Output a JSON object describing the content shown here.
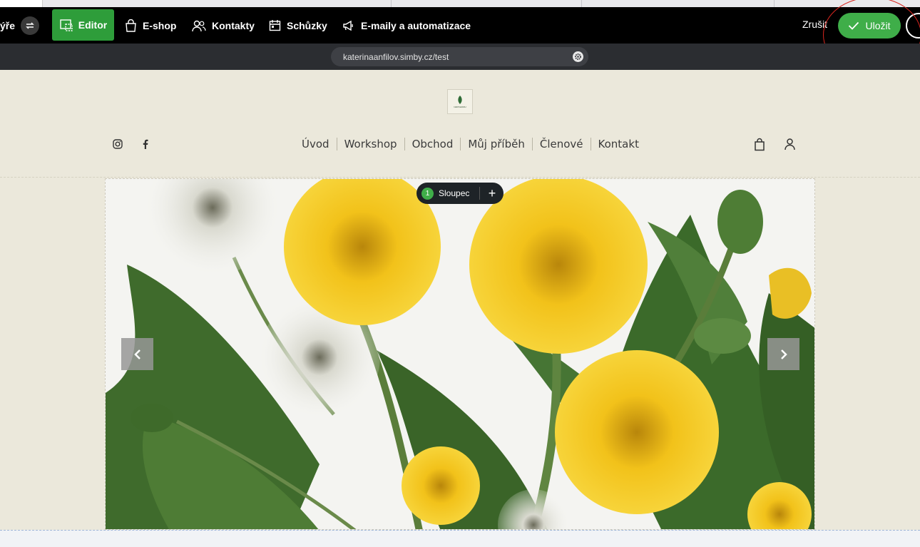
{
  "toolbar": {
    "cut_label": "ýře",
    "editor_label": "Editor",
    "eshop_label": "E-shop",
    "contacts_label": "Kontakty",
    "meetings_label": "Schůzky",
    "emails_label": "E-maily a automatizace",
    "cancel_label": "Zrušit",
    "save_label": "Uložit"
  },
  "urlbar": {
    "url": "katerinaanfilov.simby.cz/test"
  },
  "site": {
    "logo_text": "NAPOHODU",
    "nav": [
      "Úvod",
      "Workshop",
      "Obchod",
      "Můj příběh",
      "Členové",
      "Kontakt"
    ]
  },
  "editor": {
    "column_count": "1",
    "column_label": "Sloupec",
    "add_symbol": "+"
  },
  "colors": {
    "accent_green": "#3fae49",
    "editor_green": "#2e9d3a",
    "site_bg": "#ebe8db",
    "annotation_red": "#d8261f"
  },
  "icons": [
    "swap-icon",
    "editor-icon",
    "shopping-bag-icon",
    "contacts-icon",
    "calendar-icon",
    "megaphone-icon",
    "check-icon",
    "gear-icon",
    "instagram-icon",
    "facebook-icon",
    "cart-icon",
    "user-icon",
    "chevron-left-icon",
    "chevron-right-icon",
    "plus-icon"
  ]
}
